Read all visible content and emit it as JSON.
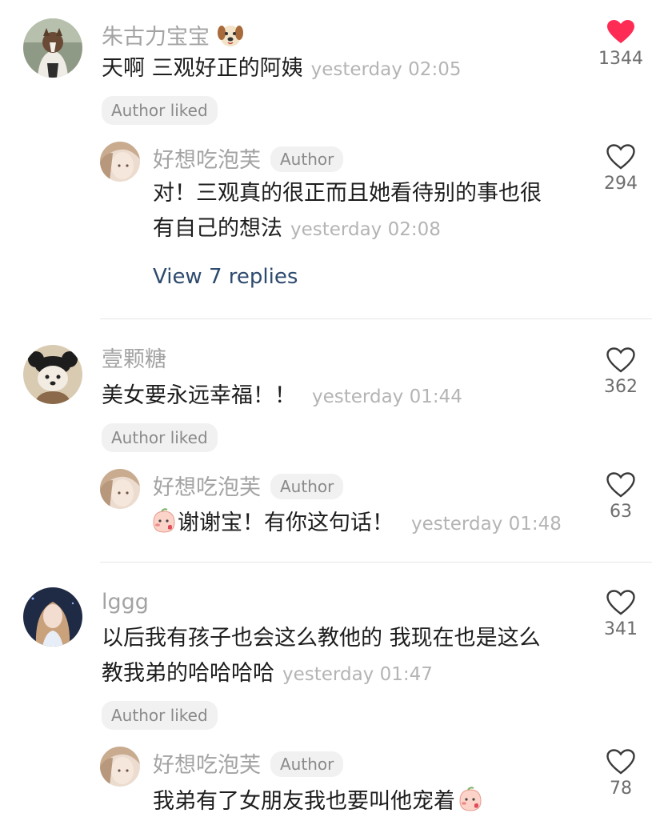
{
  "comments": [
    {
      "user": "朱古力宝宝",
      "user_emoji": "dog-face-emoji",
      "text": "天啊 三观好正的阿姨",
      "time": "yesterday 02:05",
      "tag": "Author liked",
      "likes": "1344",
      "liked": true,
      "reply": {
        "user": "好想吃泡芙",
        "badge": "Author",
        "text_line1": "对！三观真的很正而且她看待别的事也很",
        "text_line2": "有自己的想法",
        "time": "yesterday 02:08",
        "likes": "294"
      },
      "view_replies": "View 7 replies"
    },
    {
      "user": "壹颗糖",
      "text": "美女要永远幸福！！",
      "time": "yesterday 01:44",
      "tag": "Author liked",
      "likes": "362",
      "liked": false,
      "reply": {
        "user": "好想吃泡芙",
        "badge": "Author",
        "emoji": "peach-kiss-emoji",
        "text": "谢谢宝！有你这句话！",
        "time": "yesterday 01:48",
        "likes": "63"
      }
    },
    {
      "user": "lggg",
      "text_line1": "以后我有孩子也会这么教他的 我现在也是这么",
      "text_line2": "教我弟的哈哈哈哈",
      "time": "yesterday 01:47",
      "tag": "Author liked",
      "likes": "341",
      "liked": false,
      "reply": {
        "user": "好想吃泡芙",
        "badge": "Author",
        "text": "我弟有了女朋友我也要叫他宠着",
        "emoji": "peach-kiss-emoji",
        "likes": "78"
      }
    }
  ],
  "colors": {
    "like_active": "#fe2c55",
    "link": "#2e4a6e"
  }
}
